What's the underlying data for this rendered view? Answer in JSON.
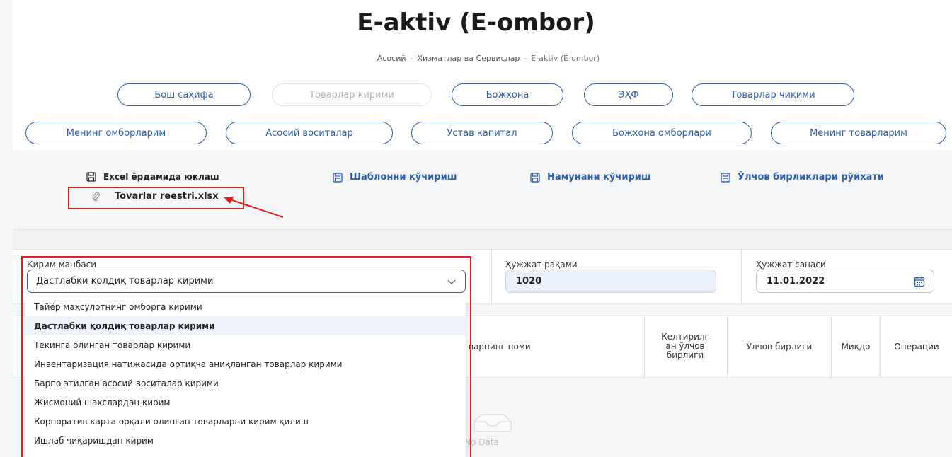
{
  "page": {
    "title": "E-aktiv (E-ombor)",
    "breadcrumb": [
      "Асосий",
      "Хизматлар ва Сервислар",
      "E-aktiv (E-ombor)"
    ]
  },
  "nav_row1": [
    "Бош саҳифа",
    "Товарлар кирими",
    "Божхона",
    "ЭҲФ",
    "Товарлар чиқими"
  ],
  "nav_row2": [
    "Менинг омборларим",
    "Асосий воситалар",
    "Устав капитал",
    "Божхона омборлари",
    "Менинг товарларим"
  ],
  "links": {
    "excel_upload": "Excel ёрдамида юклаш",
    "template_download": "Шаблонни кўчириш",
    "sample_download": "Намунани кўчириш",
    "units_list": "Ўлчов бирликлари рўйхати"
  },
  "attached_file": "Tovarlar reestri.xlsx",
  "form": {
    "source_label": "Кирим манбаси",
    "source_value": "Дастлабки қолдиқ товарлар кирими",
    "doc_number_label": "Ҳужжат рақами",
    "doc_number_value": "1020",
    "doc_date_label": "Ҳужжат санаси",
    "doc_date_value": "11.01.2022"
  },
  "dropdown_options": [
    "Тайёр маҳсулотнинг омборга кирими",
    "Дастлабки қолдиқ товарлар кирими",
    "Текинга олинган товарлар кирими",
    "Инвентаризация натижасида ортиқча аниқланган товарлар кирими",
    "Барпо этилган асосий воситалар кирими",
    "Жисмоний шахслардан кирим",
    "Корпоратив карта орқали олинган товарларни кирим қилиш",
    "Ишлаб чиқаришдан кирим"
  ],
  "table": {
    "col_name": "варнинг номи",
    "col_brought_unit": "Келтирилг ан ўлчов бирлиги",
    "col_unit": "Ўлчов бирлиги",
    "col_qty": "Миқдо",
    "col_ops": "Операции",
    "empty": "No Data"
  },
  "colors": {
    "accent": "#2f5db0",
    "highlight": "#e0201c"
  }
}
